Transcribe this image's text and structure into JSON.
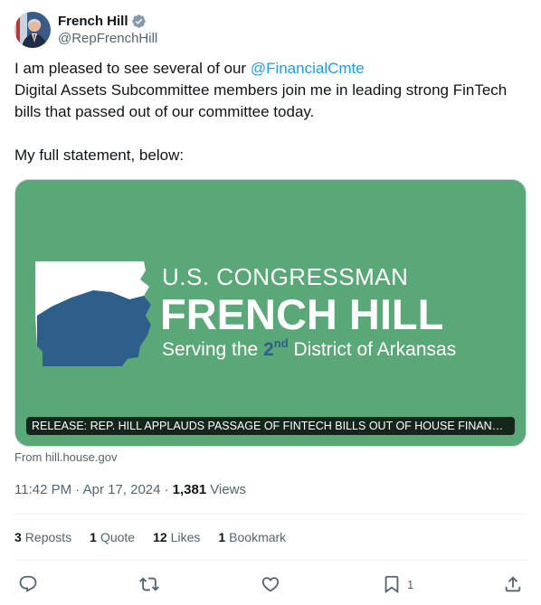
{
  "author": {
    "display_name": "French Hill",
    "handle": "@RepFrenchHill",
    "verified_icon": "verified-badge-icon"
  },
  "tweet": {
    "line1_prefix": "I am pleased to see several of our ",
    "mention": "@FinancialCmte",
    "line2": "Digital Assets Subcommittee members join me in leading strong FinTech bills that passed out of our committee today.",
    "line3": "My full statement, below:"
  },
  "card": {
    "image_line1": "U.S. CONGRESSMAN",
    "image_line2": "FRENCH HILL",
    "image_line3_prefix": "Serving the ",
    "image_line3_num": "2",
    "image_line3_sup": "nd",
    "image_line3_suffix": " District of Arkansas",
    "caption": "RELEASE: REP. HILL APPLAUDS PASSAGE OF FINTECH BILLS OUT OF HOUSE FINANCI...",
    "source": "From hill.house.gov",
    "bg_color": "#5aa777",
    "accent_blue": "#2e5f8a"
  },
  "meta": {
    "time": "11:42 PM · Apr 17, 2024 ·",
    "views_count": "1,381",
    "views_label": "Views"
  },
  "stats": {
    "reposts_num": "3",
    "reposts_label": "Reposts",
    "quotes_num": "1",
    "quotes_label": "Quote",
    "likes_num": "12",
    "likes_label": "Likes",
    "bookmarks_num": "1",
    "bookmarks_label": "Bookmark"
  },
  "actions": {
    "reply_icon": "reply-icon",
    "repost_icon": "repost-icon",
    "like_icon": "heart-icon",
    "bookmark_icon": "bookmark-icon",
    "bookmark_count": "1",
    "share_icon": "share-icon"
  },
  "colors": {
    "link": "#1d9bf0",
    "secondary_text": "#536471",
    "primary_text": "#0f1419"
  }
}
